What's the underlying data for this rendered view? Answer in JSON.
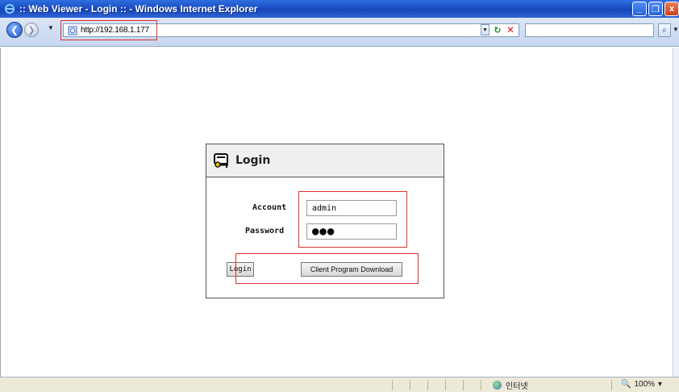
{
  "window": {
    "title": ":: Web Viewer - Login :: - Windows Internet Explorer",
    "minimize_glyph": "_",
    "restore_glyph": "❐",
    "close_glyph": "x"
  },
  "addressbar": {
    "url": "http://192.168.1.177",
    "back_glyph": "❮",
    "forward_glyph": "❯"
  },
  "login": {
    "title": "Login",
    "account_label": "Account",
    "account_value": "admin",
    "password_label": "Password",
    "password_mask": "●●●",
    "login_button": "Login",
    "download_button": "Client Program Download"
  },
  "statusbar": {
    "zone_text": "인터넷",
    "zoom_text": "100%"
  },
  "colors": {
    "highlight": "#e03030",
    "titlebar": "#1a4fc4"
  }
}
